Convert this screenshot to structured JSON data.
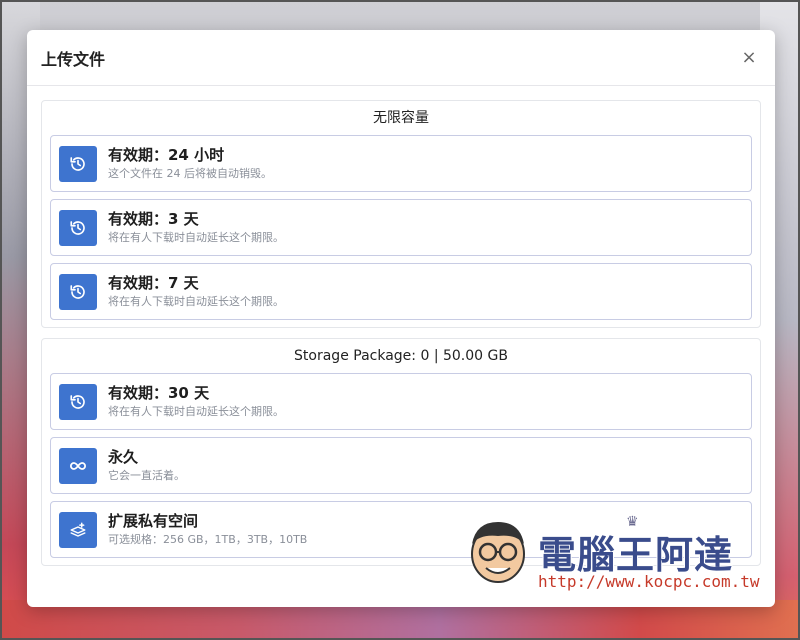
{
  "modal": {
    "title": "上传文件",
    "close_label": "×"
  },
  "groups": [
    {
      "title": "无限容量",
      "options": [
        {
          "icon": "history-icon",
          "title": "有效期：24 小时",
          "desc": "这个文件在 24 后将被自动销毁。"
        },
        {
          "icon": "history-icon",
          "title": "有效期：3 天",
          "desc": "将在有人下载时自动延长这个期限。"
        },
        {
          "icon": "history-icon",
          "title": "有效期：7 天",
          "desc": "将在有人下载时自动延长这个期限。"
        }
      ]
    },
    {
      "title": "Storage Package: 0 | 50.00 GB",
      "options": [
        {
          "icon": "history-icon",
          "title": "有效期：30 天",
          "desc": "将在有人下载时自动延长这个期限。"
        },
        {
          "icon": "infinity-icon",
          "title": "永久",
          "desc": "它会一直活着。"
        },
        {
          "icon": "layers-plus-icon",
          "title": "扩展私有空间",
          "desc": "可选规格：256 GB，1TB，3TB，10TB"
        }
      ]
    }
  ],
  "watermark": {
    "brand": "電腦王阿達",
    "url": "http://www.kocpc.com.tw"
  },
  "colors": {
    "accent": "#3e74cf",
    "option_border": "#c8cce4"
  }
}
